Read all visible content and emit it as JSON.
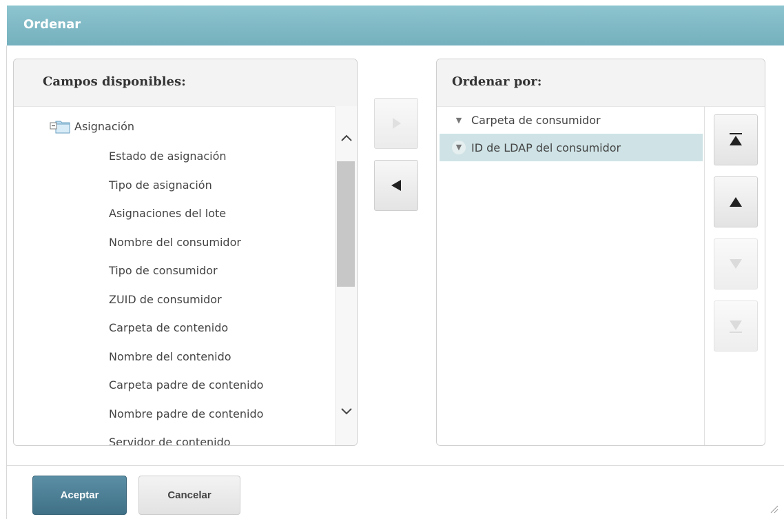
{
  "dialog": {
    "title": "Ordenar",
    "ok_label": "Aceptar",
    "cancel_label": "Cancelar"
  },
  "available": {
    "title": "Campos disponibles:",
    "root_label": "Asignación",
    "fields": [
      "Estado de asignación",
      "Tipo de asignación",
      "Asignaciones del lote",
      "Nombre del consumidor",
      "Tipo de consumidor",
      "ZUID de consumidor",
      "Carpeta de contenido",
      "Nombre del contenido",
      "Carpeta padre de contenido",
      "Nombre padre de contenido",
      "Servidor de contenido"
    ]
  },
  "sort": {
    "title": "Ordenar por:",
    "items": [
      {
        "label": "Carpeta de consumidor",
        "caret": "▼",
        "selected": false
      },
      {
        "label": "ID de LDAP del consumidor",
        "caret": "▼",
        "selected": true
      }
    ]
  },
  "icons": {
    "folder": "folder-icon",
    "add": "arrow-right-icon",
    "remove": "arrow-left-icon",
    "move_top": "move-to-top-icon",
    "move_up": "move-up-icon",
    "move_down": "move-down-icon",
    "move_bottom": "move-to-bottom-icon"
  },
  "colors": {
    "titlebar": "#7fb9c5",
    "selected_row": "#cfe3e6",
    "primary_button": "#4a7d93"
  }
}
